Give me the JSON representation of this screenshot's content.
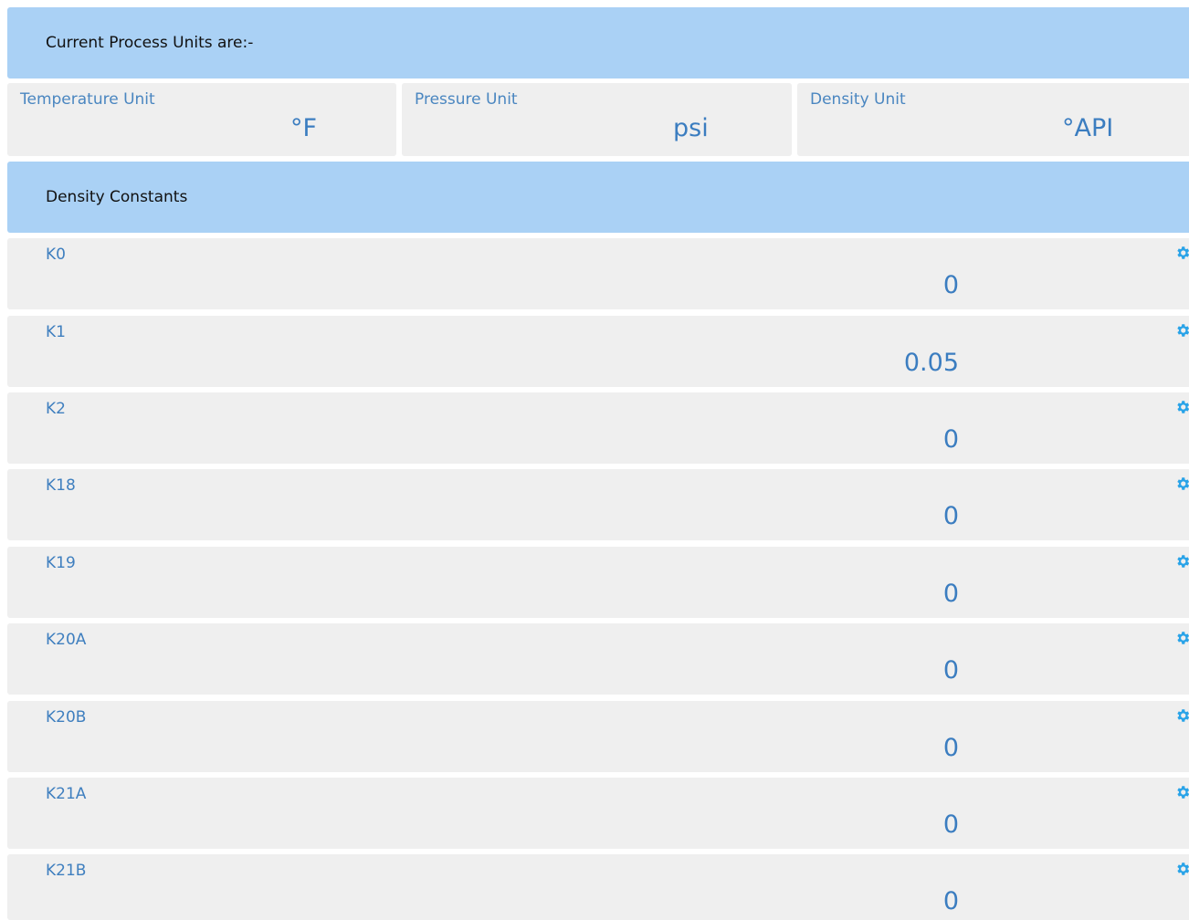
{
  "process_units": {
    "header": "Current Process Units are:-",
    "temperature": {
      "label": "Temperature Unit",
      "value": "°F"
    },
    "pressure": {
      "label": "Pressure Unit",
      "value": "psi"
    },
    "density": {
      "label": "Density Unit",
      "value": "°API"
    }
  },
  "density_constants": {
    "header": "Density Constants",
    "items": [
      {
        "label": "K0",
        "value": "0"
      },
      {
        "label": "K1",
        "value": "0.05"
      },
      {
        "label": "K2",
        "value": "0"
      },
      {
        "label": "K18",
        "value": "0"
      },
      {
        "label": "K19",
        "value": "0"
      },
      {
        "label": "K20A",
        "value": "0"
      },
      {
        "label": "K20B",
        "value": "0"
      },
      {
        "label": "K21A",
        "value": "0"
      },
      {
        "label": "K21B",
        "value": "0"
      }
    ]
  },
  "icons": {
    "edit": "gear-icon"
  },
  "colors": {
    "header_bg": "#aad1f5",
    "card_bg": "#efefef",
    "label": "#4a86c0",
    "value": "#3b7dc0",
    "gear": "#29a3e8"
  }
}
